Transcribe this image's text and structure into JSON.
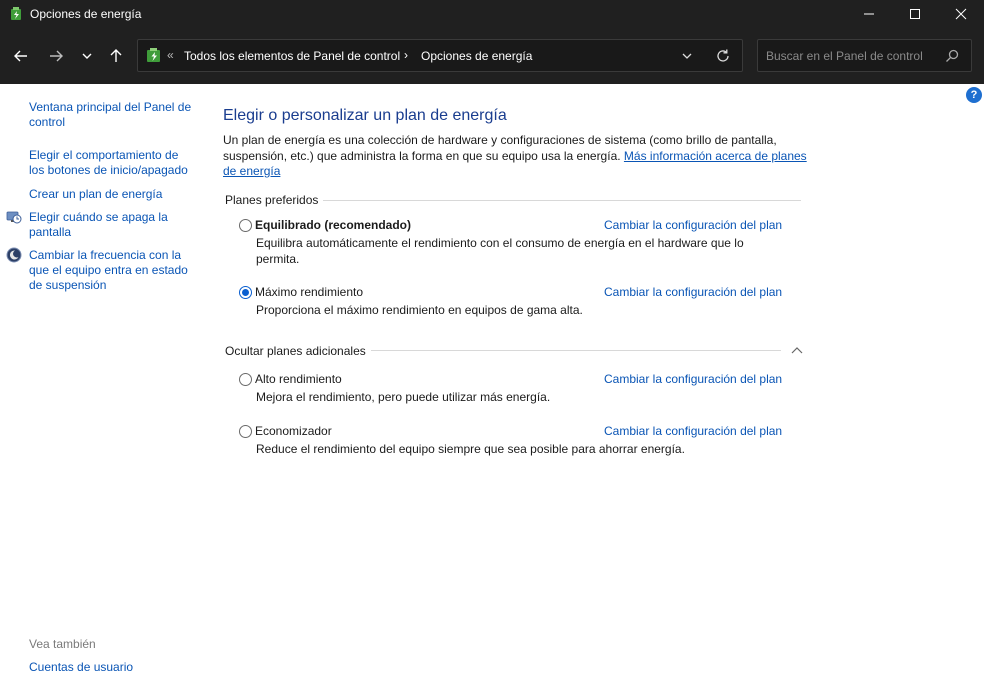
{
  "window": {
    "title": "Opciones de energía",
    "icon": "power-options-icon"
  },
  "toolbar": {
    "breadcrumb": [
      "Todos los elementos de Panel de control",
      "Opciones de energía"
    ],
    "search_placeholder": "Buscar en el Panel de control"
  },
  "sidebar": {
    "links": [
      "Ventana principal del Panel de control",
      "Elegir el comportamiento de los botones de inicio/apagado",
      "Crear un plan de energía",
      "Elegir cuándo se apaga la pantalla",
      "Cambiar la frecuencia con la que el equipo entra en estado de suspensión"
    ],
    "see_also_title": "Vea también",
    "see_also_links": [
      "Cuentas de usuario"
    ]
  },
  "main": {
    "heading": "Elegir o personalizar un plan de energía",
    "intro_text": "Un plan de energía es una colección de hardware y configuraciones de sistema (como brillo de pantalla, suspensión, etc.) que administra la forma en que su equipo usa la energía.",
    "intro_link": "Más información acerca de planes de energía",
    "preferred_title": "Planes preferidos",
    "additional_title": "Ocultar planes adicionales",
    "change_link": "Cambiar la configuración del plan",
    "preferred_plans": [
      {
        "name": "Equilibrado (recomendado)",
        "description": "Equilibra automáticamente el rendimiento con el consumo de energía en el hardware que lo permita.",
        "selected": false
      },
      {
        "name": "Máximo rendimiento",
        "description": "Proporciona el máximo rendimiento en equipos de gama alta.",
        "selected": true
      }
    ],
    "additional_plans": [
      {
        "name": "Alto rendimiento",
        "description": "Mejora el rendimiento, pero puede utilizar más energía.",
        "selected": false
      },
      {
        "name": "Economizador",
        "description": "Reduce el rendimiento del equipo siempre que sea posible para ahorrar energía.",
        "selected": false
      }
    ]
  },
  "colors": {
    "accent": "#0a5fd0",
    "link": "#0a55b5",
    "heading": "#1a3d8f",
    "titlebar": "#202020"
  }
}
